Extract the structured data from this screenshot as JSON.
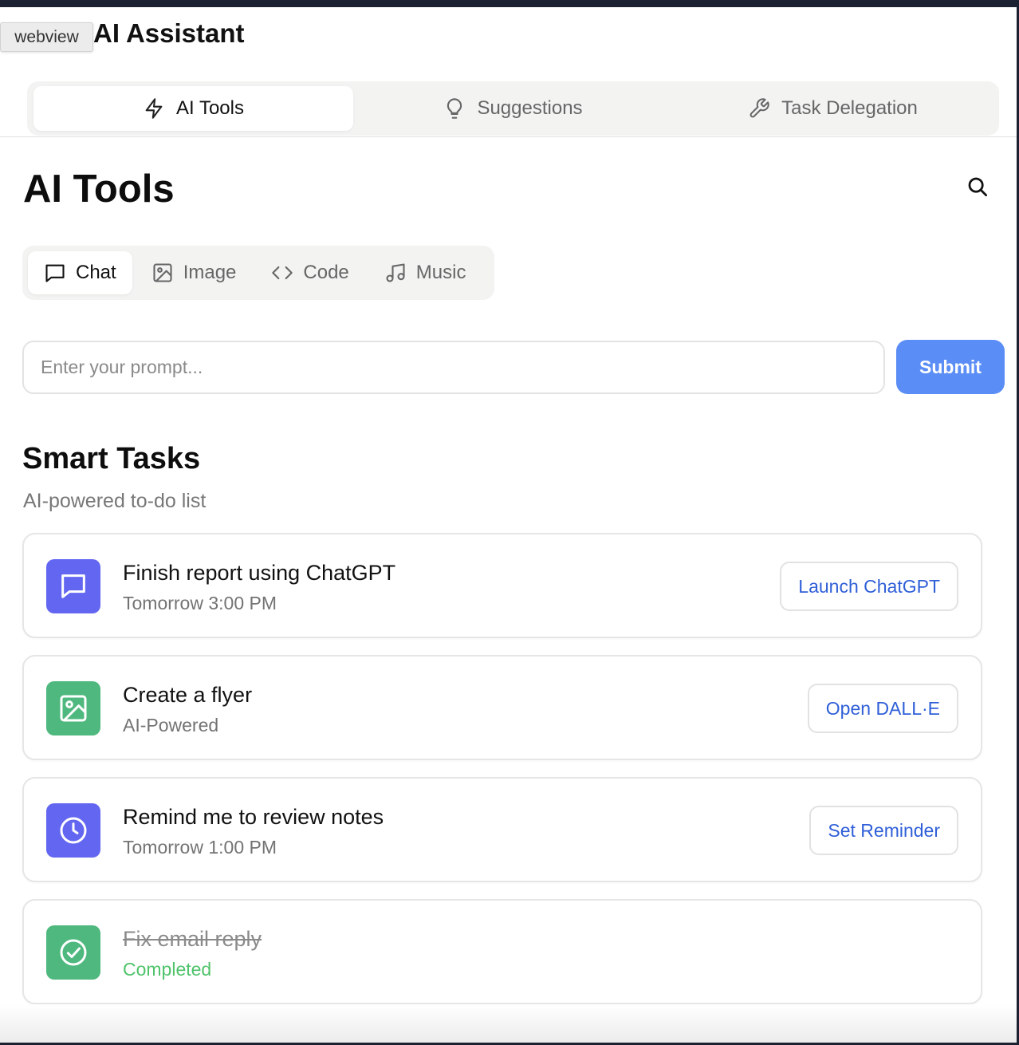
{
  "header": {
    "title": "AI Assistant",
    "webview_label": "webview"
  },
  "top_tabs": [
    {
      "label": "AI Tools",
      "icon": "lightning-icon",
      "active": true
    },
    {
      "label": "Suggestions",
      "icon": "lightbulb-icon",
      "active": false
    },
    {
      "label": "Task Delegation",
      "icon": "wrench-icon",
      "active": false
    }
  ],
  "main": {
    "title": "AI Tools",
    "sub_tabs": [
      {
        "label": "Chat",
        "icon": "chat-bubble-icon",
        "active": true
      },
      {
        "label": "Image",
        "icon": "image-icon",
        "active": false
      },
      {
        "label": "Code",
        "icon": "code-icon",
        "active": false
      },
      {
        "label": "Music",
        "icon": "music-note-icon",
        "active": false
      }
    ],
    "prompt": {
      "placeholder": "Enter your prompt...",
      "value": ""
    },
    "submit_label": "Submit"
  },
  "smart_tasks": {
    "title": "Smart Tasks",
    "subtitle": "AI-powered to-do list",
    "items": [
      {
        "title": "Finish report using ChatGPT",
        "meta": "Tomorrow 3:00 PM",
        "action": "Launch ChatGPT",
        "icon": "chat-bubble-icon",
        "icon_color": "#6366f1",
        "completed": false
      },
      {
        "title": "Create a flyer",
        "meta": "AI-Powered",
        "action": "Open DALL·E",
        "icon": "image-icon",
        "icon_color": "#4fb87e",
        "completed": false
      },
      {
        "title": "Remind me to review notes",
        "meta": "Tomorrow 1:00 PM",
        "action": "Set Reminder",
        "icon": "clock-icon",
        "icon_color": "#6366f1",
        "completed": false
      },
      {
        "title": "Fix email reply",
        "meta": "Completed",
        "action": "",
        "icon": "check-circle-icon",
        "icon_color": "#4fb87e",
        "completed": true
      }
    ]
  },
  "colors": {
    "accent": "#5a8df5",
    "link": "#2f5fd8",
    "purple": "#6366f1",
    "green": "#4fb87e",
    "completed_text": "#4fc36a"
  }
}
